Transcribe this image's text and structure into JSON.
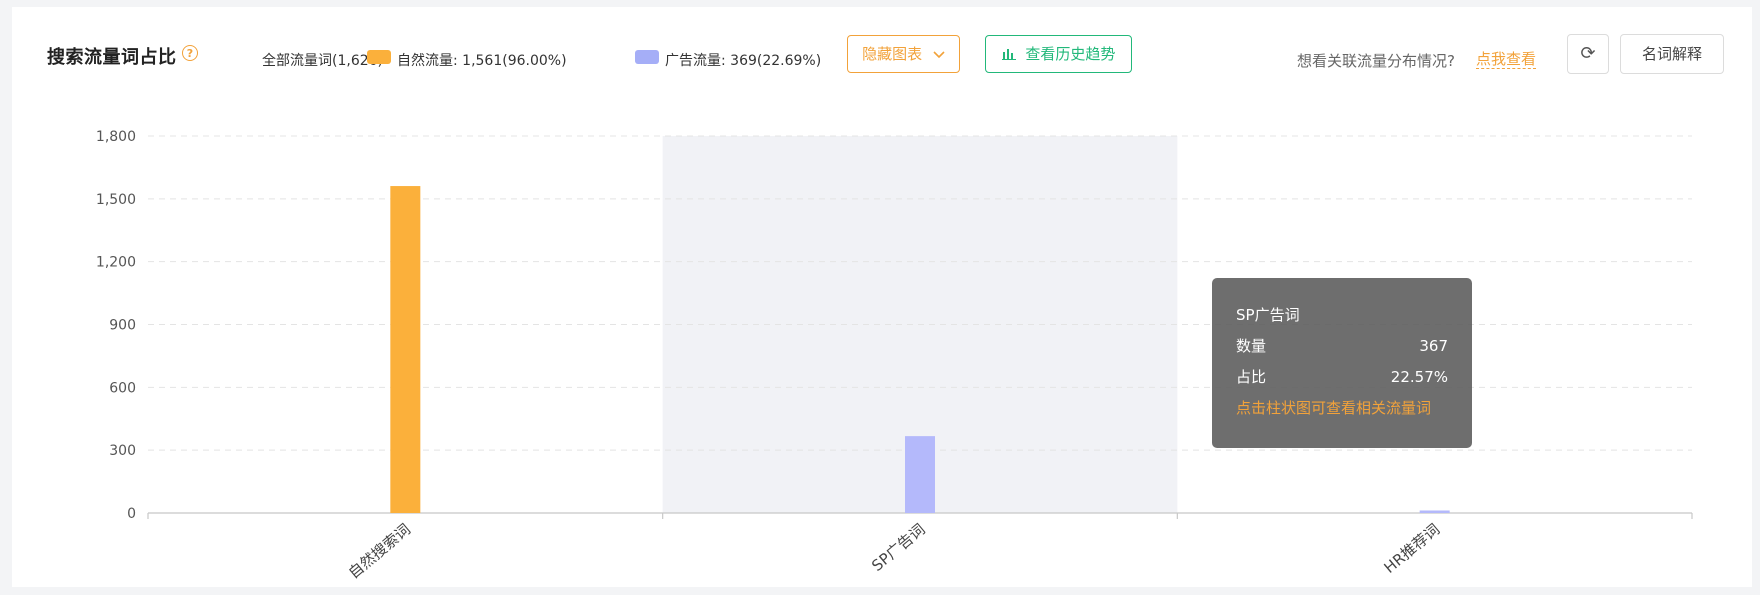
{
  "header": {
    "title": "搜索流量词占比",
    "help_icon": "?",
    "legend_total": "全部流量词(1,626)",
    "legend_natural": "自然流量: 1,561(96.00%)",
    "legend_ad": "广告流量: 369(22.69%)",
    "hide_chart_label": "隐藏图表",
    "history_label": "查看历史趋势",
    "hint_text": "想看关联流量分布情况?",
    "hint_link": "点我查看",
    "refresh_icon": "⟳",
    "terms_label": "名词解释"
  },
  "colors": {
    "natural": "#fbb03b",
    "ad": "#a5aef7",
    "ad_bar": "#b4b9fb",
    "highlight": "#f1f2f6",
    "accent_orange": "#f2a23a",
    "accent_green": "#22b87a"
  },
  "tooltip": {
    "title": "SP广告词",
    "count_label": "数量",
    "count_value": "367",
    "ratio_label": "占比",
    "ratio_value": "22.57%",
    "note": "点击柱状图可查看相关流量词"
  },
  "chart_data": {
    "type": "bar",
    "categories": [
      "自然搜索词",
      "SP广告词",
      "HR推荐词"
    ],
    "series": [
      {
        "name": "自然流量",
        "values": [
          1561,
          0,
          0
        ]
      },
      {
        "name": "广告流量",
        "values": [
          0,
          367,
          12
        ]
      }
    ],
    "y_ticks": [
      "0",
      "300",
      "600",
      "900",
      "1,200",
      "1,500",
      "1,800"
    ],
    "ylim": [
      0,
      1800
    ],
    "highlighted_category": 1,
    "grid": true
  }
}
